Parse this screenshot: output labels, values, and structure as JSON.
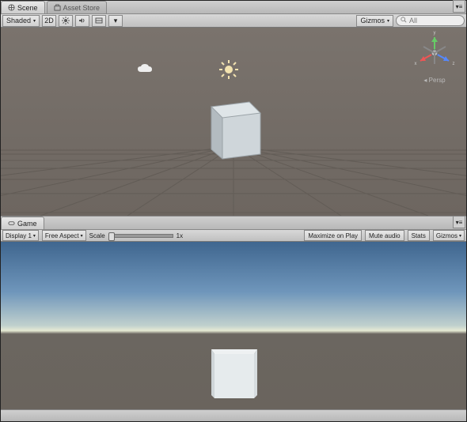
{
  "scene_tab_bar": {
    "scene_tab": "Scene",
    "asset_store_tab": "Asset Store"
  },
  "scene_toolbar": {
    "shading_mode": "Shaded",
    "mode_2d": "2D",
    "gizmos_label": "Gizmos",
    "search_placeholder": "All"
  },
  "scene_gizmo": {
    "persp_label": "Persp",
    "x": "x",
    "y": "y",
    "z": "z"
  },
  "game_tab_bar": {
    "game_tab": "Game"
  },
  "game_toolbar": {
    "display": "Display 1",
    "aspect": "Free Aspect",
    "scale_label": "Scale",
    "scale_value": "1x",
    "maximize": "Maximize on Play",
    "mute": "Mute audio",
    "stats": "Stats",
    "gizmos": "Gizmos"
  }
}
